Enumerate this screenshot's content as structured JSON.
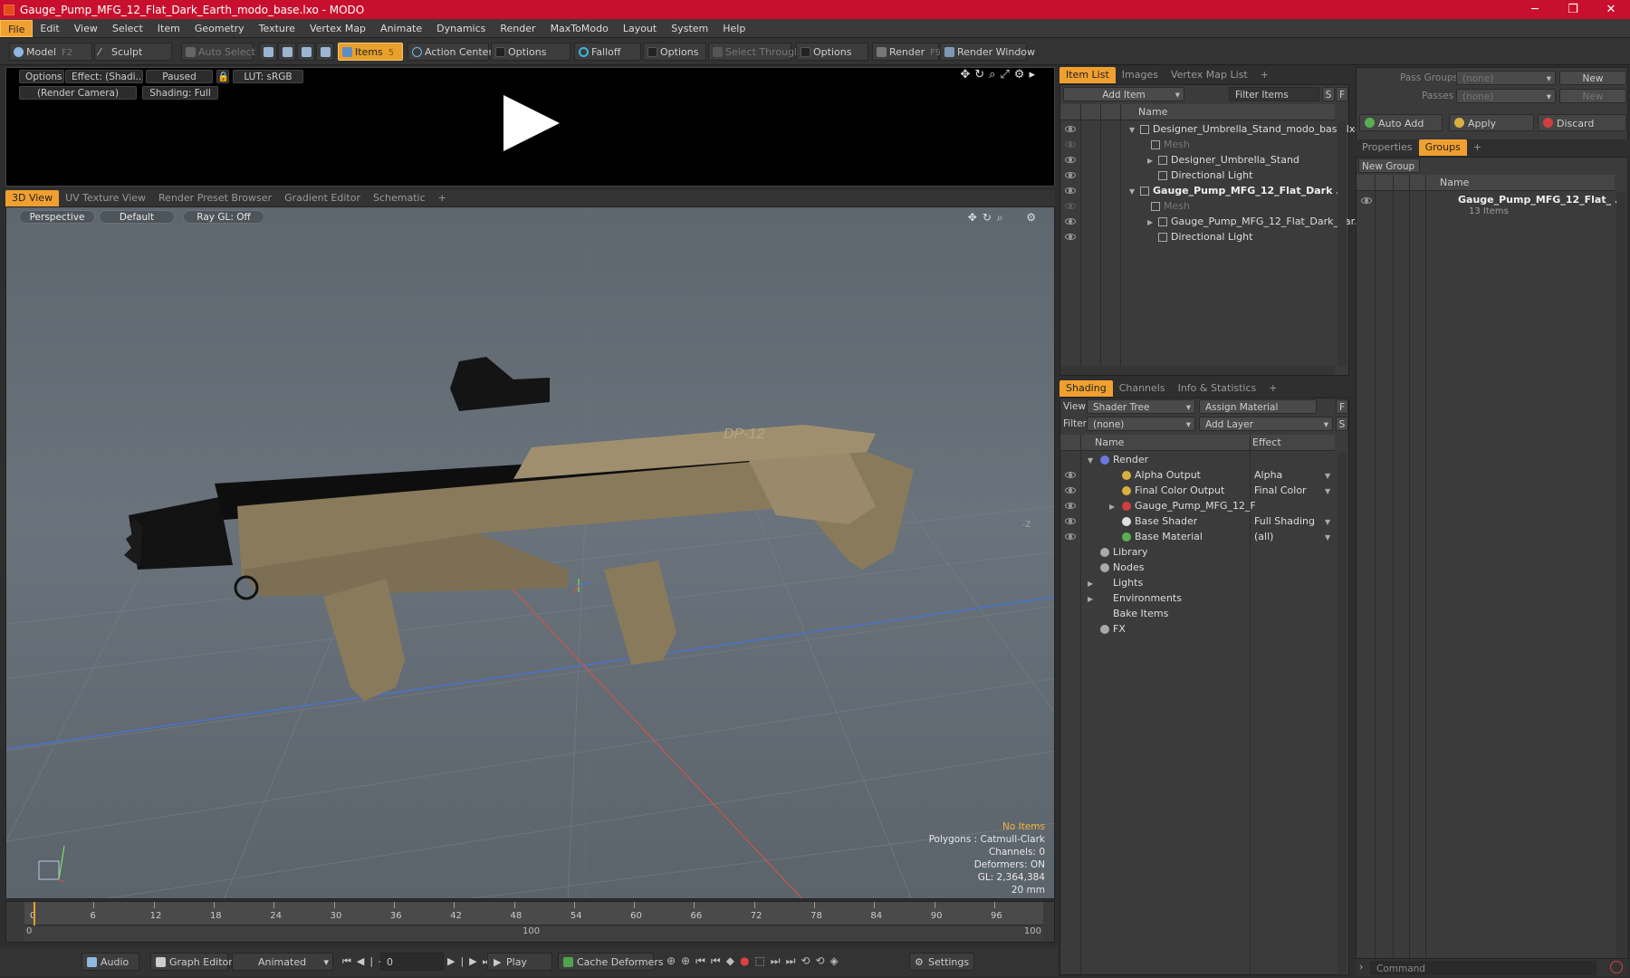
{
  "window": {
    "title": "Gauge_Pump_MFG_12_Flat_Dark_Earth_modo_base.lxo - MODO",
    "min": "─",
    "max": "❐",
    "close": "✕"
  },
  "menu": [
    "File",
    "Edit",
    "View",
    "Select",
    "Item",
    "Geometry",
    "Texture",
    "Vertex Map",
    "Animate",
    "Dynamics",
    "Render",
    "MaxToModo",
    "Layout",
    "System",
    "Help"
  ],
  "toolbar": {
    "model": "Model",
    "model_key": "F2",
    "sculpt": "Sculpt",
    "auto_select": "Auto Select",
    "items": "Items",
    "items_key": "5",
    "action_center": "Action Center",
    "options1": "Options",
    "falloff": "Falloff",
    "options2": "Options",
    "select_through": "Select Through",
    "options3": "Options",
    "render": "Render",
    "render_key": "F9",
    "render_window": "Render Window"
  },
  "preview": {
    "options": "Options",
    "effect": "Effect: (Shadi...",
    "paused": "Paused",
    "lut": "LUT: sRGB",
    "camera": "(Render Camera)",
    "shading": "Shading: Full"
  },
  "view_tabs": [
    "3D View",
    "UV Texture View",
    "Render Preset Browser",
    "Gradient Editor",
    "Schematic",
    "+"
  ],
  "viewport": {
    "perspective": "Perspective",
    "default": "Default",
    "raygl": "Ray GL: Off",
    "stats": {
      "no_items": "No Items",
      "polygons": "Polygons : Catmull-Clark",
      "channels": "Channels: 0",
      "deformers": "Deformers: ON",
      "gl": "GL: 2,364,384",
      "mm": "20 mm"
    },
    "gun_label": "DP-12",
    "axis_z": "-Z"
  },
  "timeline": {
    "ticks": [
      "0",
      "6",
      "12",
      "18",
      "24",
      "30",
      "36",
      "42",
      "48",
      "54",
      "60",
      "66",
      "72",
      "78",
      "84",
      "90",
      "96"
    ],
    "sub_start": "0",
    "sub_mid": "100",
    "sub_end": "100"
  },
  "bottombar": {
    "audio": "Audio",
    "graph_editor": "Graph Editor",
    "animated": "Animated",
    "frame": "0",
    "play": "Play",
    "cache": "Cache Deformers",
    "settings": "Settings"
  },
  "itemlist": {
    "tabs": [
      "Item List",
      "Images",
      "Vertex Map List",
      "+"
    ],
    "add_item": "Add Item",
    "filter": "Filter Items",
    "s": "S",
    "f": "F",
    "col_name": "Name",
    "rows": [
      "Designer_Umbrella_Stand_modo_base.lxo",
      "Mesh",
      "Designer_Umbrella_Stand",
      "Directional Light",
      "Gauge_Pump_MFG_12_Flat_Dark ...",
      "Mesh",
      "Gauge_Pump_MFG_12_Flat_Dark_Ear...",
      "Directional Light"
    ]
  },
  "shading": {
    "tabs": [
      "Shading",
      "Channels",
      "Info & Statistics",
      "+"
    ],
    "view_label": "View",
    "view_value": "Shader Tree",
    "assign": "Assign Material",
    "f": "F",
    "filter_label": "Filter",
    "filter_value": "(none)",
    "add_layer": "Add Layer",
    "s": "S",
    "col_name": "Name",
    "col_effect": "Effect",
    "rows": [
      {
        "name": "Render",
        "effect": ""
      },
      {
        "name": "Alpha Output",
        "effect": "Alpha"
      },
      {
        "name": "Final Color Output",
        "effect": "Final Color"
      },
      {
        "name": "Gauge_Pump_MFG_12_Fla...",
        "effect": ""
      },
      {
        "name": "Base Shader",
        "effect": "Full Shading"
      },
      {
        "name": "Base Material",
        "effect": "(all)"
      },
      {
        "name": "Library",
        "effect": ""
      },
      {
        "name": "Nodes",
        "effect": ""
      },
      {
        "name": "Lights",
        "effect": ""
      },
      {
        "name": "Environments",
        "effect": ""
      },
      {
        "name": "Bake Items",
        "effect": ""
      },
      {
        "name": "FX",
        "effect": ""
      }
    ]
  },
  "right": {
    "pass_groups": "Pass Groups",
    "passes": "Passes",
    "none": "(none)",
    "new": "New",
    "auto_add": "Auto Add",
    "apply": "Apply",
    "discard": "Discard",
    "tabs": [
      "Properties",
      "Groups",
      "+"
    ],
    "new_group": "New Group",
    "col_name": "Name",
    "group_name": "Gauge_Pump_MFG_12_Flat_ ...",
    "group_count": "13 Items",
    "command": "Command"
  },
  "colors": {
    "accent": "#f0a030",
    "title_bar": "#c8102e",
    "gun_tan": "#8a7a5c"
  }
}
